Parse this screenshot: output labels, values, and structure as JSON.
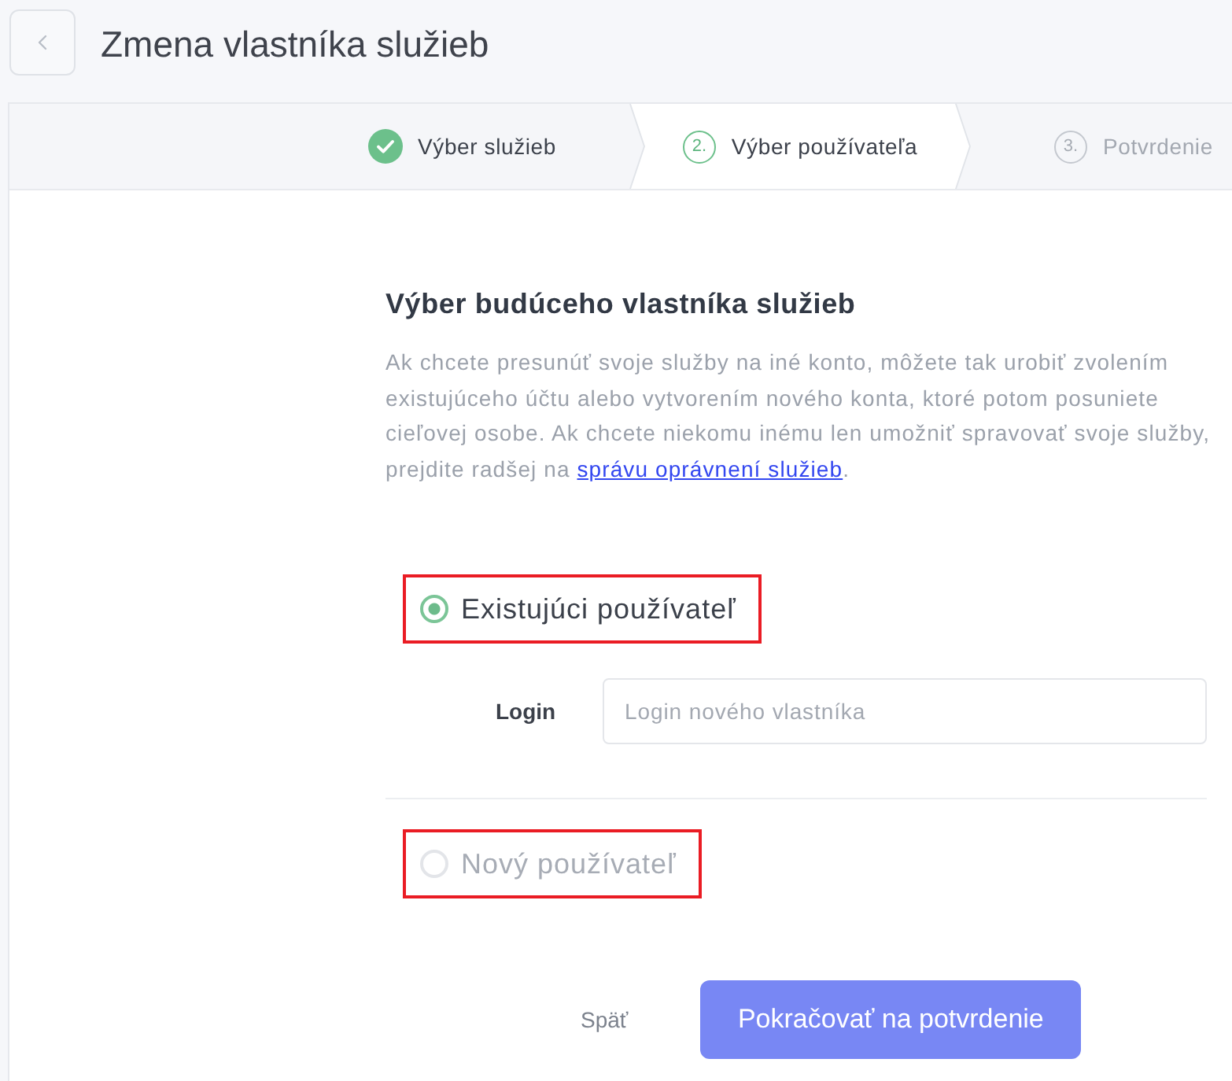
{
  "header": {
    "title": "Zmena vlastníka služieb"
  },
  "steps": [
    {
      "label": "Výber služieb",
      "completed": true,
      "selected": false
    },
    {
      "number": "2.",
      "label": "Výber používateľa",
      "completed": false,
      "selected": true
    },
    {
      "number": "3.",
      "label": "Potvrdenie",
      "completed": false,
      "selected": false
    }
  ],
  "form": {
    "heading": "Výber budúceho vlastníka služieb",
    "description": "Ak chcete presunúť svoje služby na iné konto, môžete tak urobiť zvolením existujúceho účtu alebo vytvorením nového konta, ktoré potom posuniete cieľovej osobe. Ak chcete niekomu inému len umožniť spravovať svoje služby, prejdite radšej na ",
    "link": "správu oprávnení služieb",
    "description_end": ".",
    "options": [
      {
        "label": "Existujúci používateľ",
        "selected": true,
        "highlighted": true,
        "fields": [
          {
            "label": "Login",
            "placeholder": "Login nového vlastníka"
          }
        ]
      },
      {
        "label": "Nový používateľ",
        "selected": false,
        "highlighted": true
      }
    ]
  },
  "actions": {
    "back": "Späť",
    "continue": "Pokračovať na potvrdenie"
  }
}
